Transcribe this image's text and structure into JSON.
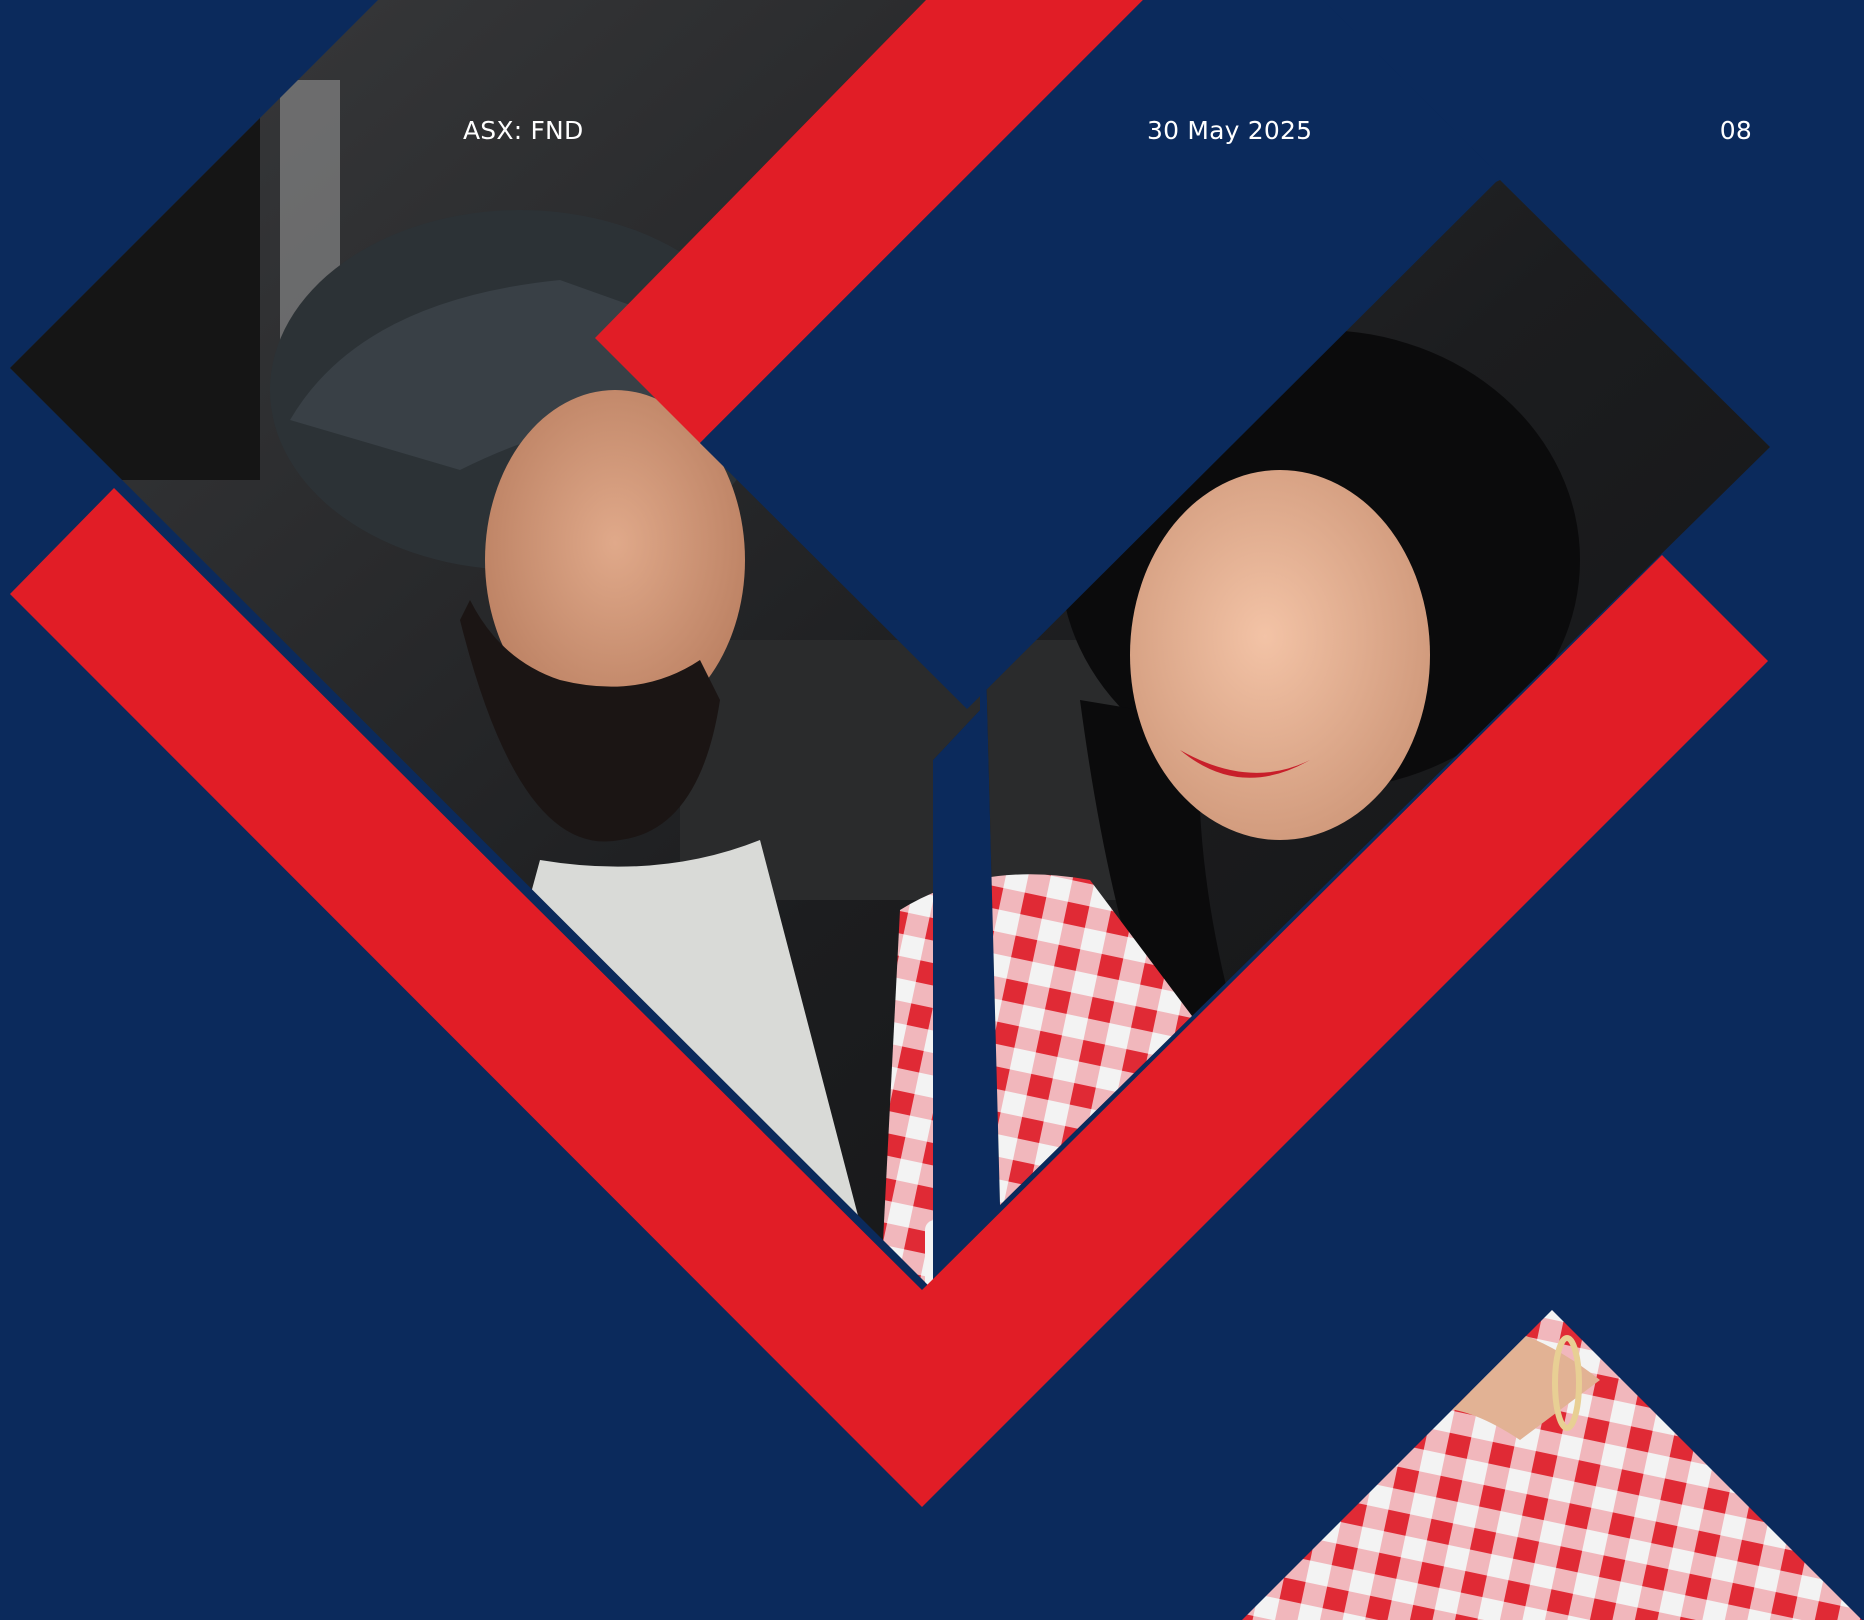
{
  "header": {
    "ticker": "ASX: FND",
    "date": "30 May 2025",
    "page_number": "08"
  },
  "colors": {
    "background_navy": "#0b2a5c",
    "accent_red": "#e11d26",
    "white": "#ffffff"
  },
  "images": [
    {
      "name": "couple-photo",
      "description": "smiling man in dark turban and woman in red-and-white checked top"
    },
    {
      "name": "checked-fabric-photo",
      "description": "arm with bangle over red-and-white checked fabric"
    }
  ]
}
